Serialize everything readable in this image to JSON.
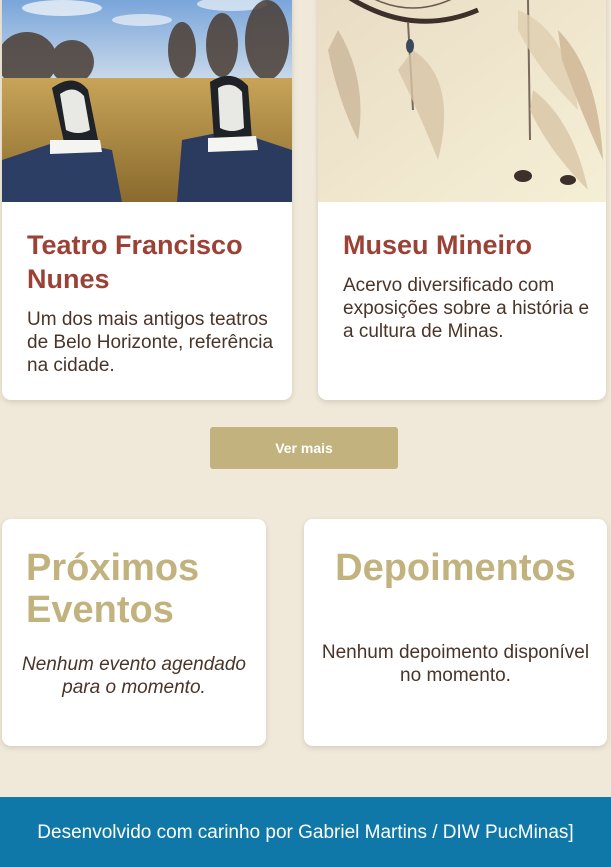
{
  "attractions": [
    {
      "title": "Teatro Francisco Nunes",
      "description": "Um dos mais antigos teatros de Belo Horizonte, referência na cidade."
    },
    {
      "title": "Museu Mineiro",
      "description": "Acervo diversificado com exposições sobre a história e a cultura de Minas."
    }
  ],
  "ver_mais_label": "Ver mais",
  "events": {
    "title": "Próximos Eventos",
    "empty_message": "Nenhum evento agendado para o momento."
  },
  "testimonials": {
    "title": "Depoimentos",
    "empty_message": "Nenhum depoimento disponível no momento."
  },
  "footer": {
    "text": "Desenvolvido com carinho por Gabriel Martins / DIW PucMinas]"
  },
  "colors": {
    "background": "#f0e8d8",
    "card_title": "#9b4136",
    "accent": "#c2b27e",
    "footer": "#0f78a8"
  }
}
